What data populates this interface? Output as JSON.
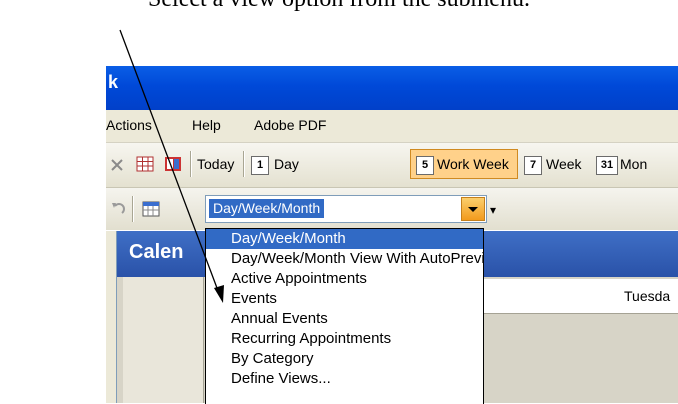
{
  "instruction": "Select a view option from the submenu.",
  "window": {
    "title": "k"
  },
  "menubar": {
    "items": [
      "Actions",
      "Help",
      "Adobe PDF"
    ]
  },
  "toolbar": {
    "today_label": "Today",
    "day_icon_text": "1",
    "day_label": "Day",
    "work_week_icon_text": "5",
    "work_week_label": "Work Week",
    "week_icon_text": "7",
    "week_label": "Week",
    "month_icon_text": "31",
    "month_label": "Mon"
  },
  "view_selector": {
    "value": "Day/Week/Month"
  },
  "calendar": {
    "header": "Calen",
    "day_header": "Tuesda"
  },
  "dropdown": {
    "options": [
      "Day/Week/Month",
      "Day/Week/Month View With AutoPreview",
      "Active Appointments",
      "Events",
      "Annual Events",
      "Recurring Appointments",
      "By Category",
      "Define Views..."
    ],
    "selected_index": 0
  },
  "colors": {
    "titlebar": "#0049d8",
    "selection": "#316ac5",
    "highlight_button": "#ffd18a"
  }
}
